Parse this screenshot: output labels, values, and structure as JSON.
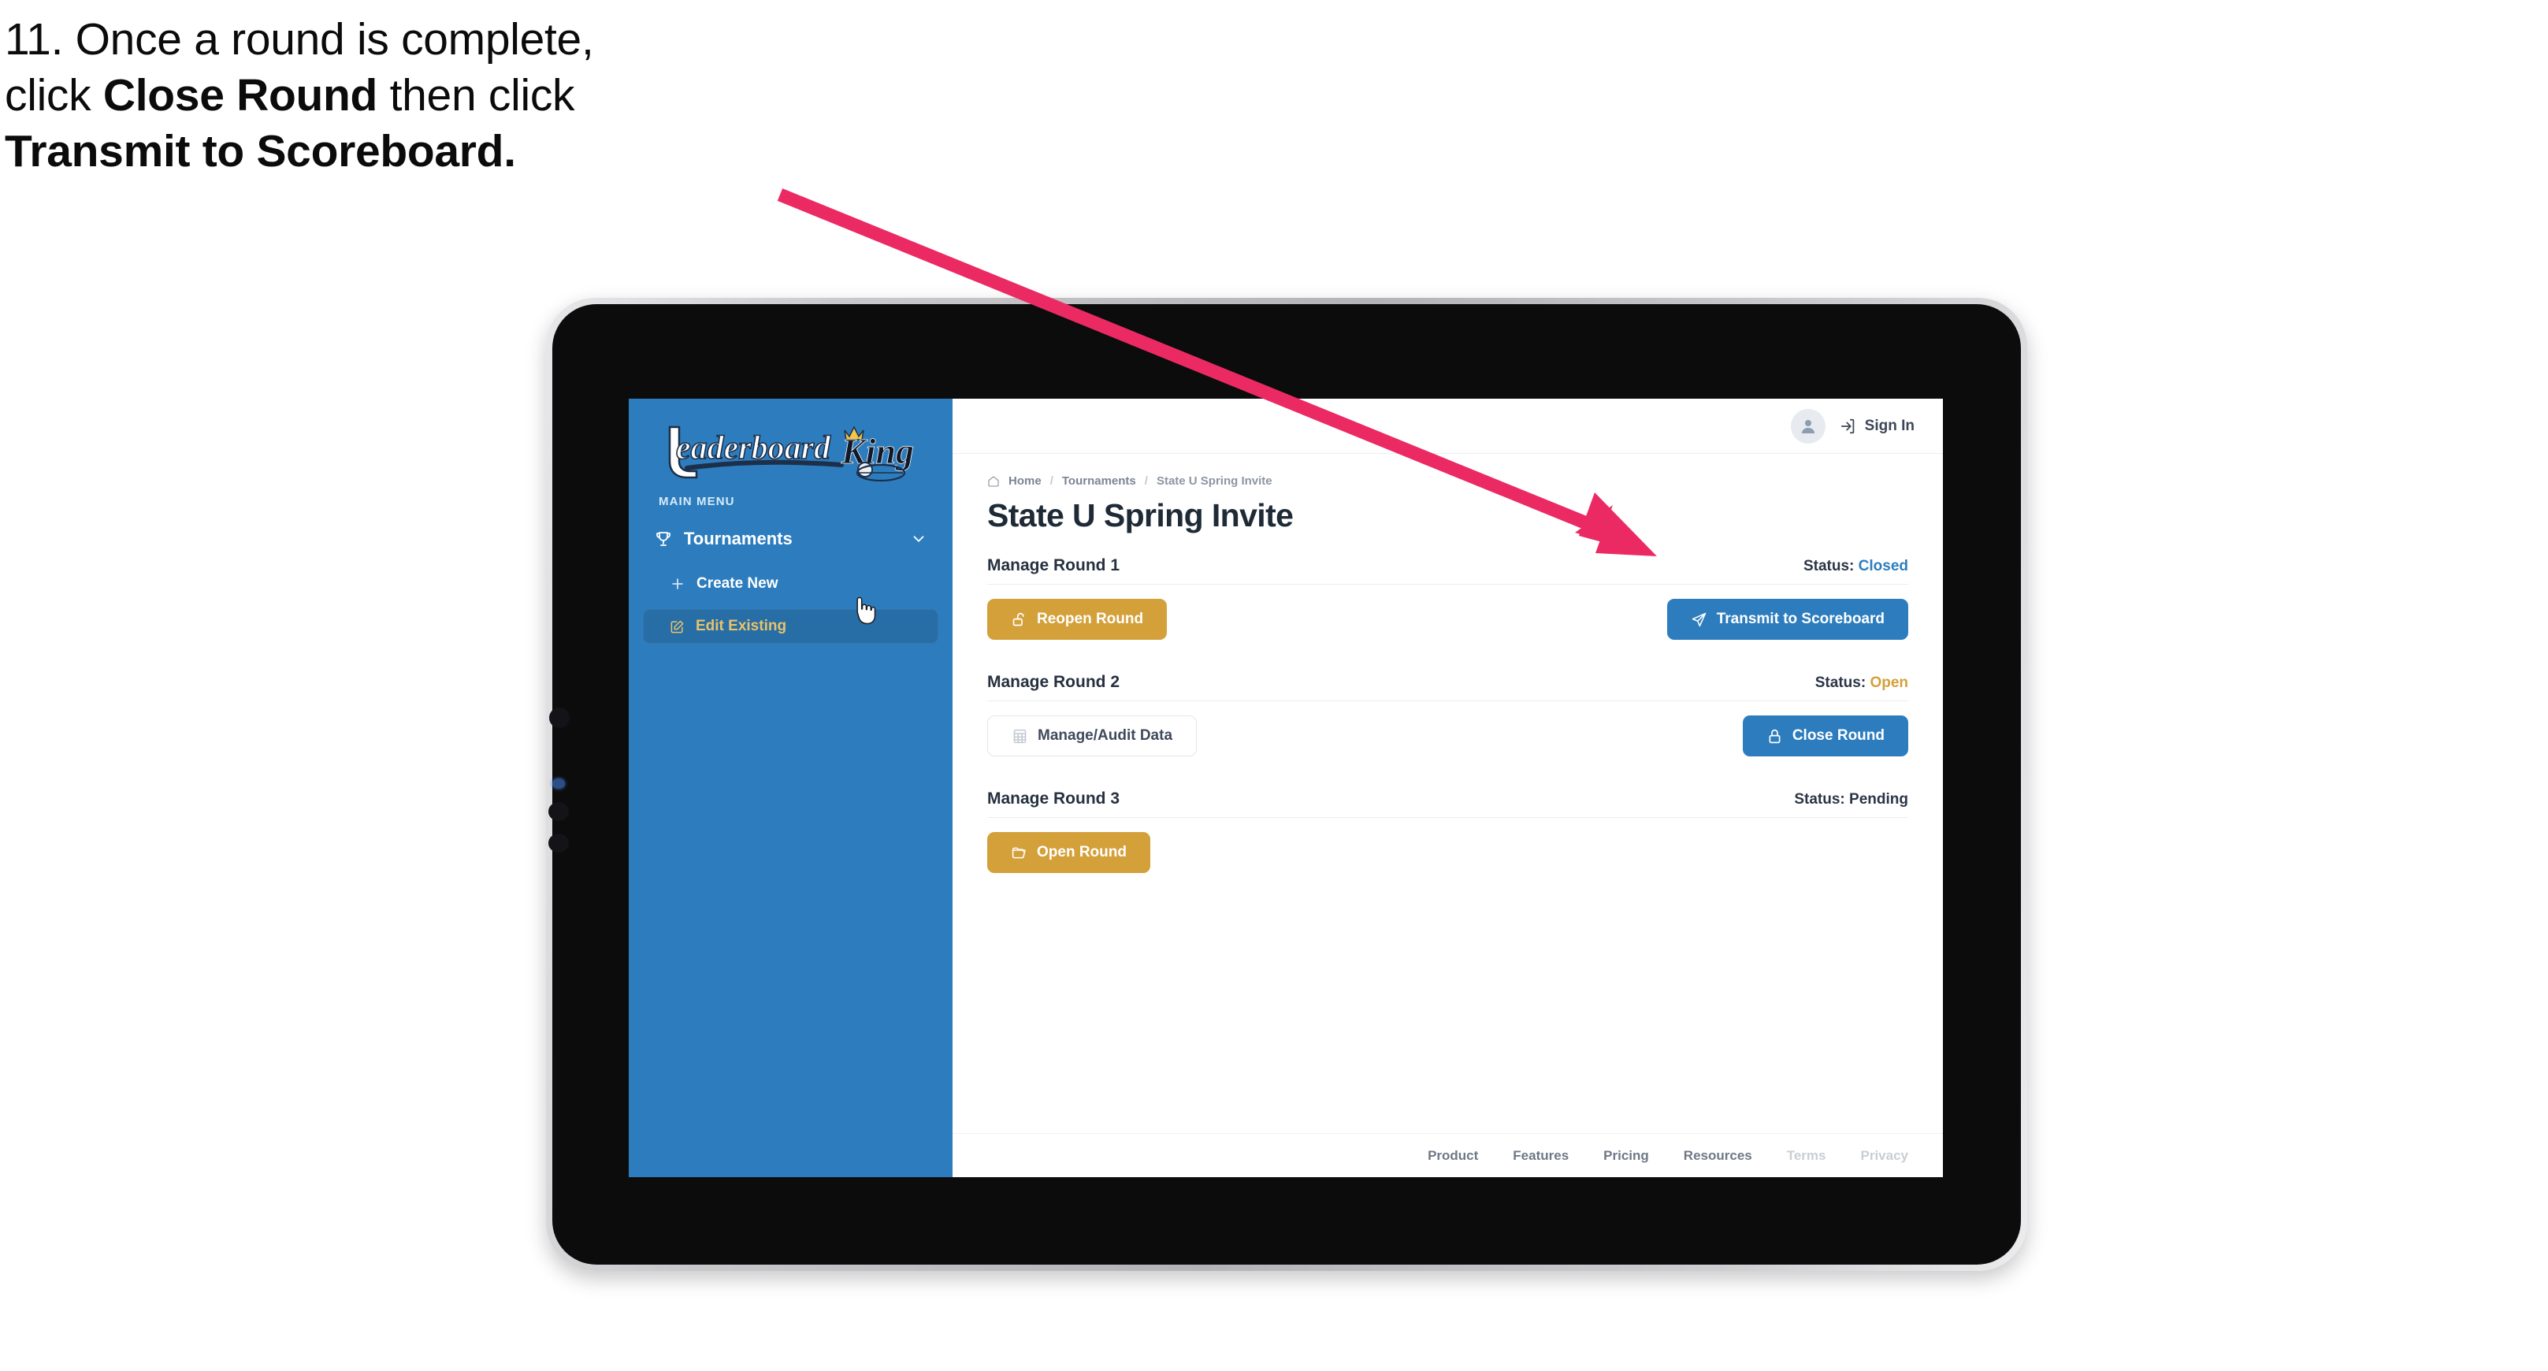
{
  "caption": {
    "line1": "11. Once a round is complete,",
    "line2_pre": "click ",
    "line2_bold": "Close Round",
    "line2_post": " then click",
    "line3_bold": "Transmit to Scoreboard."
  },
  "annotation": {
    "arrow_color": "#eb2a63",
    "arrow_from": "990,247",
    "arrow_to": "2103,706"
  },
  "app": {
    "brand": {
      "name_primary": "Leaderboard",
      "name_secondary": "King"
    },
    "sidebar": {
      "section_label": "MAIN MENU",
      "bg_color": "#2d7dbe",
      "items": [
        {
          "label": "Tournaments",
          "icon": "trophy-icon",
          "chevron": "chevron-down-icon",
          "level": "top"
        },
        {
          "label": "Create New",
          "icon": "plus-icon",
          "level": "sub",
          "active": false
        },
        {
          "label": "Edit Existing",
          "icon": "pencil-square-icon",
          "level": "sub",
          "active": true
        }
      ]
    },
    "topbar": {
      "avatar_icon": "user-avatar-icon",
      "signin_icon": "sign-in-icon",
      "signin_label": "Sign In"
    },
    "breadcrumb": {
      "home_icon": "home-icon",
      "items": [
        "Home",
        "Tournaments",
        "State U Spring Invite"
      ],
      "separator": "/"
    },
    "page_title": "State U Spring Invite",
    "rounds": [
      {
        "title": "Manage Round 1",
        "status_label": "Status:",
        "status_value": "Closed",
        "status_color": "#2d7dbe",
        "left_button": {
          "label": "Reopen Round",
          "icon": "unlock-icon",
          "style": "gold"
        },
        "right_button": {
          "label": "Transmit to Scoreboard",
          "icon": "paper-plane-icon",
          "style": "blue"
        }
      },
      {
        "title": "Manage Round 2",
        "status_label": "Status:",
        "status_value": "Open",
        "status_color": "#d4a03a",
        "left_button": {
          "label": "Manage/Audit Data",
          "icon": "table-grid-icon",
          "style": "ghost"
        },
        "right_button": {
          "label": "Close Round",
          "icon": "lock-icon",
          "style": "blue"
        }
      },
      {
        "title": "Manage Round 3",
        "status_label": "Status:",
        "status_value": "Pending",
        "status_color": "#2b3546",
        "left_button": {
          "label": "Open Round",
          "icon": "open-folder-icon",
          "style": "gold"
        },
        "right_button": null
      }
    ],
    "footer": {
      "links": [
        "Product",
        "Features",
        "Pricing",
        "Resources",
        "Terms",
        "Privacy"
      ],
      "muted_links": [
        "Terms",
        "Privacy"
      ]
    }
  }
}
